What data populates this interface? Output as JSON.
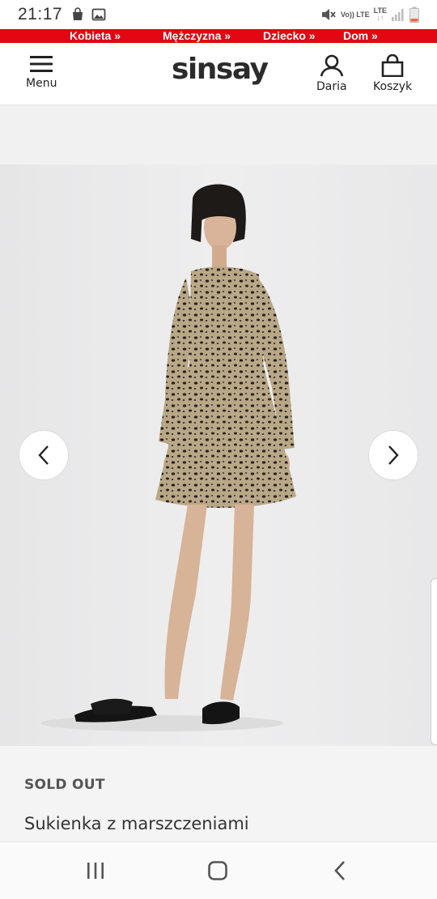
{
  "status_bar": {
    "time": "21:17",
    "left_icons": [
      "shopping-bag-icon",
      "image-icon"
    ],
    "network_top": "Vo)) LTE",
    "network_lte": "LTE",
    "right_icons": [
      "mute-icon",
      "signal-icon",
      "battery-low-icon"
    ]
  },
  "category_nav": {
    "items": [
      "Kobieta »",
      "Mężczyzna »",
      "Dziecko »",
      "Dom »"
    ],
    "background": "#e30613"
  },
  "header": {
    "menu_label": "Menu",
    "logo_text": "sinsay",
    "account_label": "Daria",
    "cart_label": "Koszyk"
  },
  "product": {
    "status": "SOLD OUT",
    "name": "Sukienka z marszczeniami"
  },
  "gallery": {
    "prev_icon": "chevron-left-icon",
    "next_icon": "chevron-right-icon"
  },
  "system_nav": {
    "icons": [
      "recent-apps-icon",
      "home-icon",
      "back-icon"
    ]
  }
}
